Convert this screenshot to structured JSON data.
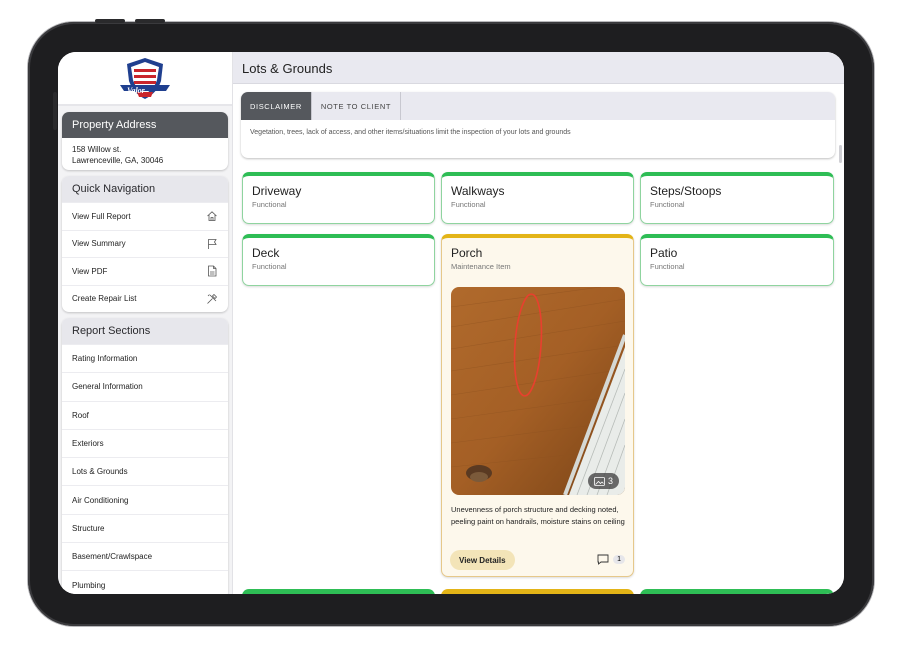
{
  "app": {
    "page_title": "Lots & Grounds"
  },
  "sidebar": {
    "logo_text": "Valor",
    "logo_sub": "Inspection",
    "logo_pro": "PRO",
    "property": {
      "header": "Property Address",
      "line1": "158 Willow st.",
      "line2": "Lawrenceville, GA, 30046"
    },
    "quick_nav": {
      "header": "Quick Navigation",
      "items": [
        {
          "label": "View Full Report",
          "icon": "home-icon"
        },
        {
          "label": "View Summary",
          "icon": "flag-icon"
        },
        {
          "label": "View PDF",
          "icon": "pdf-icon"
        },
        {
          "label": "Create Repair List",
          "icon": "tools-icon"
        }
      ]
    },
    "report_sections": {
      "header": "Report Sections",
      "items": [
        "Rating Information",
        "General Information",
        "Roof",
        "Exteriors",
        "Lots & Grounds",
        "Air Conditioning",
        "Structure",
        "Basement/Crawlspace",
        "Plumbing"
      ]
    }
  },
  "disclaimer": {
    "tabs": [
      "DISCLAIMER",
      "NOTE TO CLIENT"
    ],
    "active_tab": 0,
    "text": "Vegetation, trees, lack of access, and other items/situations limit the inspection of your lots and grounds"
  },
  "cards": [
    {
      "title": "Driveway",
      "status": "Functional"
    },
    {
      "title": "Walkways",
      "status": "Functional"
    },
    {
      "title": "Steps/Stoops",
      "status": "Functional"
    },
    {
      "title": "Deck",
      "status": "Functional"
    },
    {
      "title": "Porch",
      "status": "Maintenance Item"
    },
    {
      "title": "Patio",
      "status": "Functional"
    }
  ],
  "porch_detail": {
    "photo_count": "3",
    "description": "Unevenness of porch structure and decking noted, peeling paint on handrails, moisture stains on ceiling",
    "button_label": "View Details",
    "comment_count": "1"
  },
  "colors": {
    "functional": "#2ebd55",
    "maintenance": "#e3b417",
    "sidebar_header": "#55585d"
  }
}
